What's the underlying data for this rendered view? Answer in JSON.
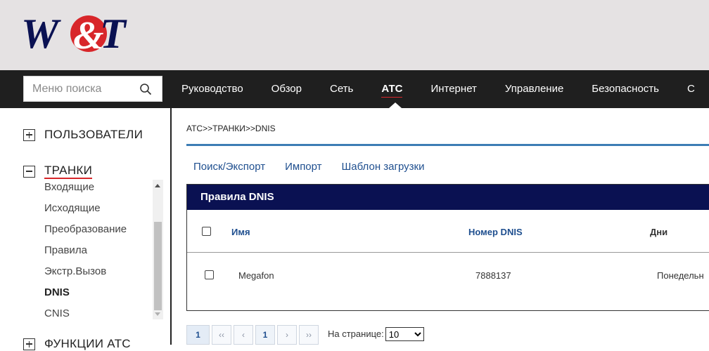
{
  "brand": {
    "logo_left": "W",
    "logo_amp": "&",
    "logo_right": "T",
    "colors": {
      "navy": "#0a1152",
      "red": "#d8262a"
    }
  },
  "nav": {
    "search_placeholder": "Меню поиска",
    "items": [
      "Руководство",
      "Обзор",
      "Сеть",
      "АТС",
      "Интернет",
      "Управление",
      "Безопасность",
      "С"
    ],
    "active_index": 3
  },
  "sidebar": {
    "users_label": "ПОЛЬЗОВАТЕЛИ",
    "trunks_label": "ТРАНКИ",
    "trunk_items": [
      "Входящие",
      "Исходящие",
      "Преобразование",
      "Правила",
      "Экстр.Вызов",
      "DNIS",
      "CNIS"
    ],
    "current_item": "DNIS",
    "next_label": "ФУНКЦИИ АТС"
  },
  "main": {
    "breadcrumb": "АТС>>ТРАНКИ>>DNIS",
    "actions": [
      "Поиск/Экспорт",
      "Импорт",
      "Шаблон загрузки"
    ],
    "panel_title": "Правила DNIS",
    "columns": {
      "name": "Имя",
      "dnis": "Номер DNIS",
      "days": "Дни"
    },
    "rows": [
      {
        "name": "Megafon",
        "dnis": "7888137",
        "days": "Понедельн"
      }
    ]
  },
  "pagination": {
    "current_page": "1",
    "first": "1",
    "prev_all": "‹‹",
    "prev": "‹",
    "page": "1",
    "next": "›",
    "next_all": "››",
    "per_page_label": "На странице:",
    "per_page_value": "10"
  }
}
